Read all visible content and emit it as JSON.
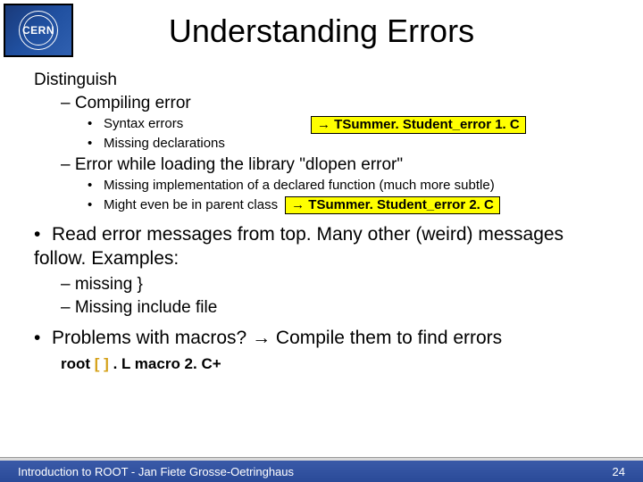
{
  "logo": {
    "text": "CERN"
  },
  "title": "Understanding Errors",
  "body": {
    "distinguish": "Distinguish",
    "compiling": "Compiling error",
    "syntax": "Syntax errors",
    "missing_decl": "Missing declarations",
    "hl1": "→ TSummer. Student_error 1. C",
    "dlopen": "Error while loading the library \"dlopen error\"",
    "missing_impl": "Missing implementation of a declared function (much more subtle)",
    "parent": "Might even be in parent class",
    "hl2": "→ TSummer. Student_error 2. C",
    "read_errors": "Read error messages from top. Many other (weird) messages follow. Examples:",
    "missing_brace": "missing }",
    "missing_include": "Missing include file",
    "problems": "Problems with macros? → Compile them to find errors",
    "code_root": "root ",
    "code_brackets": "[ ] ",
    "code_macro": ". L macro 2. C+"
  },
  "footer": {
    "left": "Introduction to ROOT - Jan Fiete Grosse-Oetringhaus",
    "right": "24"
  }
}
